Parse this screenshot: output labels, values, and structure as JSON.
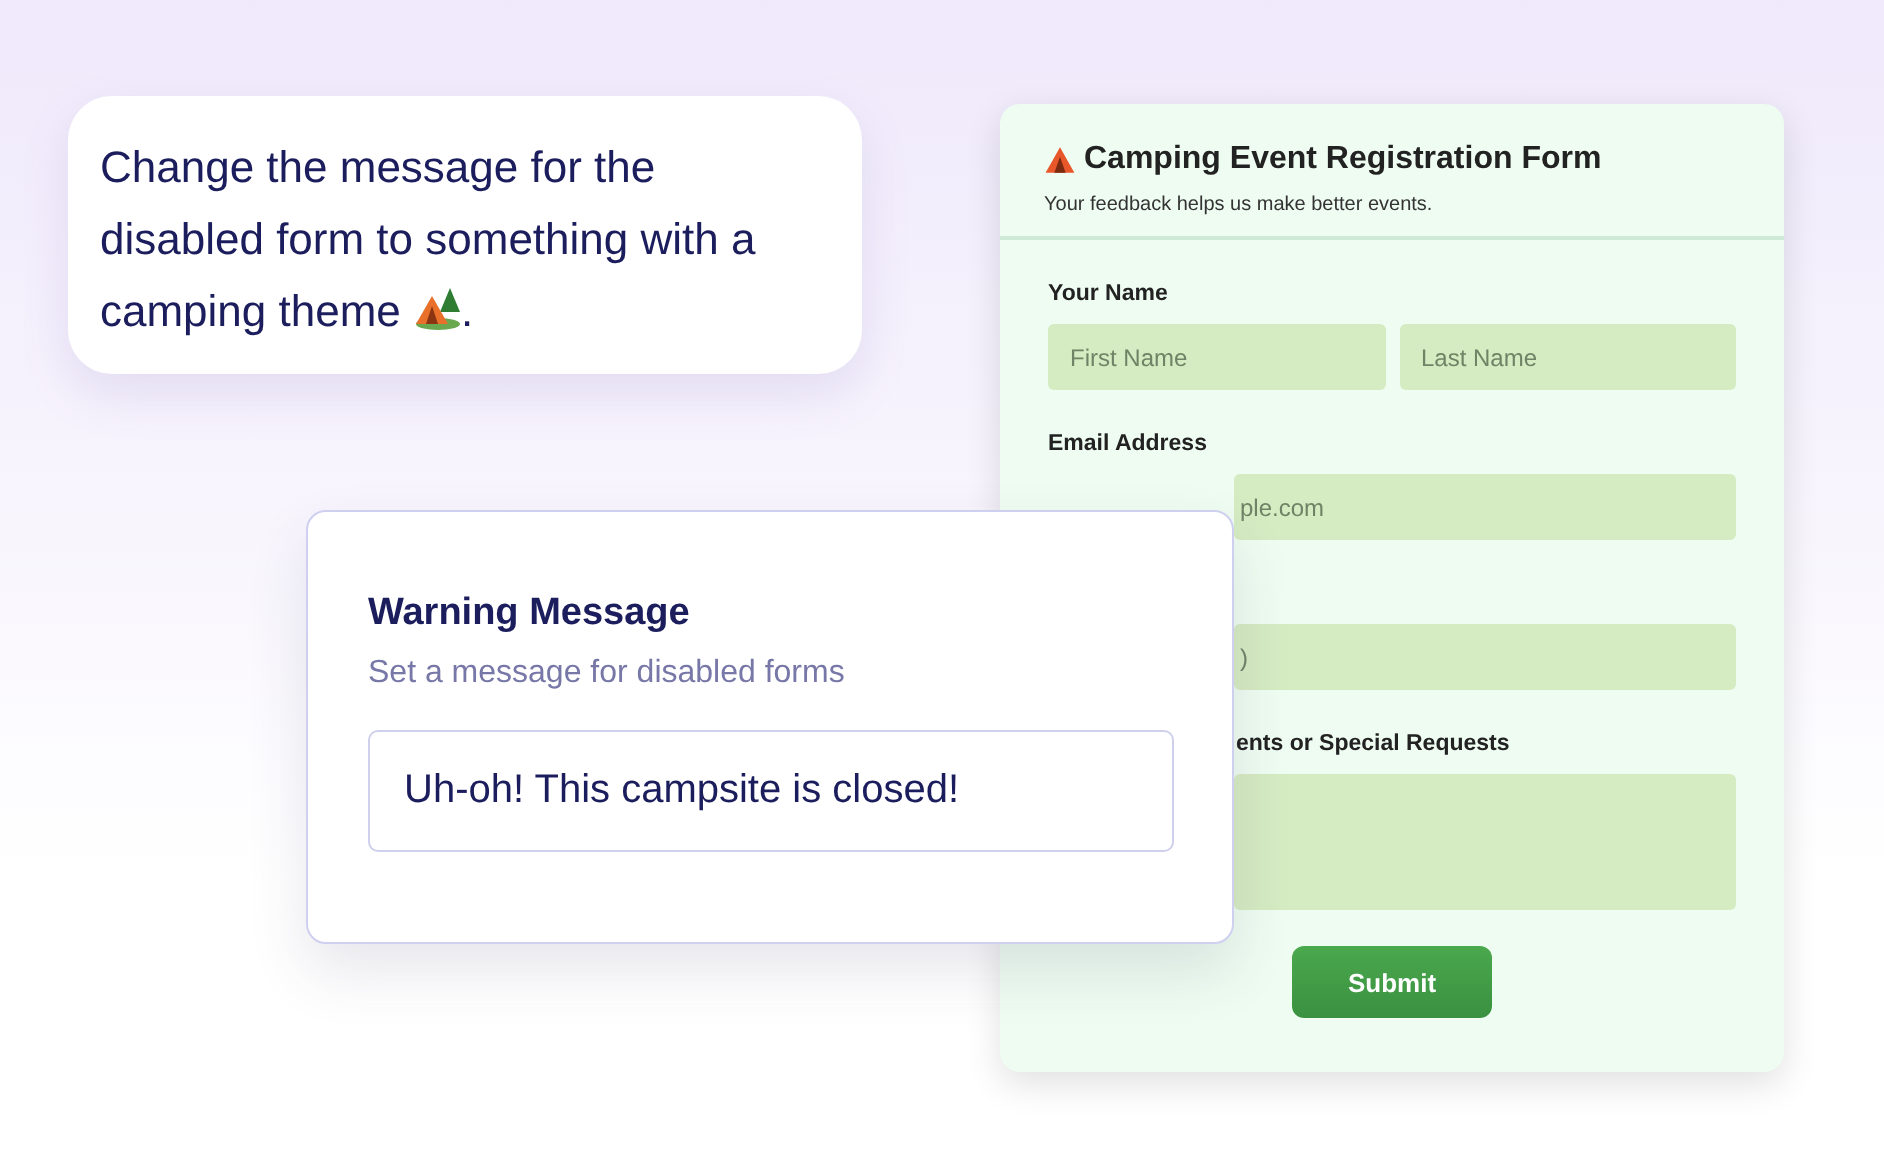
{
  "prompt": {
    "text": "Change the message for the disabled form to something with a camping theme",
    "end": "."
  },
  "form": {
    "title": "Camping Event Registration Form",
    "subtitle": "Your feedback helps us make better events.",
    "fields": [
      {
        "kind": "pair",
        "label": "Your Name",
        "inputs": [
          {
            "placeholder": "First Name"
          },
          {
            "placeholder": "Last Name"
          }
        ]
      },
      {
        "kind": "text",
        "label": "Email Address",
        "placeholder": "ple.com",
        "covered": true
      },
      {
        "kind": "text",
        "placeholder": ")",
        "covered": true
      },
      {
        "kind": "textarea",
        "label": "ents or Special Requests",
        "covered": true,
        "label_covered": true
      }
    ],
    "submit": "Submit"
  },
  "warning": {
    "title": "Warning Message",
    "subtitle": "Set a message for disabled forms",
    "value": "Uh-oh! This campsite is closed!"
  }
}
